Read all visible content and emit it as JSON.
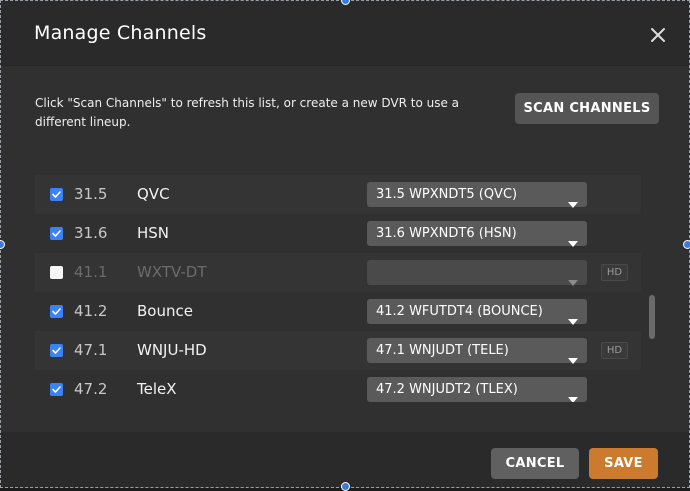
{
  "dialog": {
    "title": "Manage Channels",
    "info_text": "Click \"Scan Channels\" to refresh this list, or create a new DVR to use a different lineup.",
    "scan_button": "SCAN CHANNELS",
    "cancel_button": "CANCEL",
    "save_button": "SAVE"
  },
  "channels": [
    {
      "checked": true,
      "number": "31.5",
      "name": "QVC",
      "selection": "31.5 WPXNDT5 (QVC)",
      "hd": "",
      "disabled": false
    },
    {
      "checked": true,
      "number": "31.6",
      "name": "HSN",
      "selection": "31.6 WPXNDT6 (HSN)",
      "hd": "",
      "disabled": false
    },
    {
      "checked": false,
      "number": "41.1",
      "name": "WXTV-DT",
      "selection": "",
      "hd": "HD",
      "disabled": true
    },
    {
      "checked": true,
      "number": "41.2",
      "name": "Bounce",
      "selection": "41.2 WFUTDT4 (BOUNCE)",
      "hd": "",
      "disabled": false
    },
    {
      "checked": true,
      "number": "47.1",
      "name": "WNJU-HD",
      "selection": "47.1 WNJUDT (TELE)",
      "hd": "HD",
      "disabled": false
    },
    {
      "checked": true,
      "number": "47.2",
      "name": "TeleX",
      "selection": "47.2 WNJUDT2 (TLEX)",
      "hd": "",
      "disabled": false
    }
  ],
  "colors": {
    "accent_blue": "#3b82f6",
    "save_orange": "#cc7a2e",
    "background": "#2b2b2b"
  },
  "icons": [
    "close-icon",
    "checkmark-icon",
    "caret-down-icon"
  ]
}
